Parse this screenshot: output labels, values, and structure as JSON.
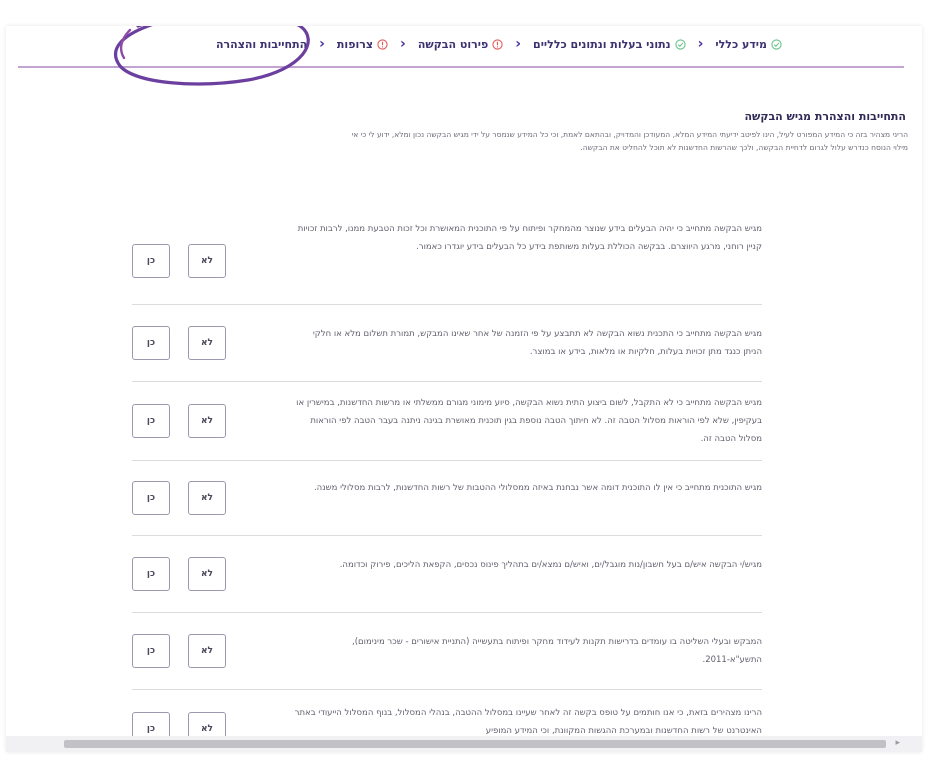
{
  "stepper": {
    "steps": [
      {
        "label": "מידע כללי",
        "state": "done"
      },
      {
        "label": "נתוני בעלות ונתונים כלליים",
        "state": "done"
      },
      {
        "label": "פירוט הבקשה",
        "state": "warning"
      },
      {
        "label": "צרופות",
        "state": "warning"
      },
      {
        "label": "התחייבות והצהרה",
        "state": "current"
      }
    ],
    "separator": "‹"
  },
  "colors": {
    "done": "#6cc08a",
    "warning": "#e05a5a",
    "accent": "#4a2f9a",
    "annotation_circle": "#6b3f9f"
  },
  "section": {
    "title": "התחייבות והצהרת מגיש הבקשה",
    "description": "הריני מצהיר בזה כי המידע המפורט לעיל, הינו לפיטב ידיעתי המידע המלא, המעודכן והמדויק, ובהתאם לאמת, וכי כל המידע שנמסר על ידי מגיש הבקשה נכון ומלא, ידוע לי כי אי מילוי הנוסח כנדרש עלול לגרום לדחיית הבקשה, ולכך שהרשות החדשנות לא תוכל להחליט את הבקשה."
  },
  "buttons": {
    "yes": "כן",
    "no": "לא"
  },
  "declarations": [
    {
      "text": "מגיש הבקשה מתחייב כי יהיה הבעלים בידע שנוצר מהמחקר ופיתוח על פי התוכנית המאושרת וכל זכות הטבעת ממנו, לרבות זכויות קניין רוחני, מרגע היווצרם. בבקשה הכוללת בעלות משותפת בידע כל הבעלים בידע יוגדרו כאמור."
    },
    {
      "text": "מגיש הבקשה מתחייב כי התכנית נשוא הבקשה לא תתבצע על פי הזמנה של אחר שאינו המבקש, תמורת תשלום מלא או חלקי הניתן כנגד מתן זכויות בעלות, חלקיות או מלאות, בידע או במוצר."
    },
    {
      "text": "מגיש הבקשה מתחייב כי לא התקבל, לשום ביצוע התית נשוא הבקשה, סיוע מימוני מגורם ממשלתי או מרשות החדשנות, במישרין או בעקיפין, שלא לפי הוראות מסלול הטבה זה. לא חיתוך הטבה נוספת בגין תוכנית מאושרת בגינה ניתנה בעבר הטבה לפי הוראות מסלול הטבה זה."
    },
    {
      "text": "מגיש התוכנית מתחייב כי אין לו התוכנית דומה אשר נבחנת באיזה ממסלולי ההטבות של רשות החדשנות, לרבות מסלולי משנה."
    },
    {
      "text": "מגיש/י הבקשה איש/ם בעל חשבון/נות מוגבל/ים, ואיש/ם נמצא/ים בתהליך פינוס נכסים, הקפאת הליכים, פירוק וכדומה."
    },
    {
      "text": "המבקש ובעלי השליטה בו עומדים בדרישות תקנות לעידוד מחקר ופיתוח בתעשייה (התניית אישורים - שכר מינימום), התשע\"א-2011."
    },
    {
      "text": "הרינו מצהירים בזאת, כי אנו חותמים על טופס בקשה זה לאחר שעיינו במסלול ההטבה, בנהלי המסלול, בנוף המסלול הייעודי באתר האינטרנט של רשות החדשנות ובמערכת ההגשות המקוונת, וכי המידע המופיע"
    }
  ]
}
